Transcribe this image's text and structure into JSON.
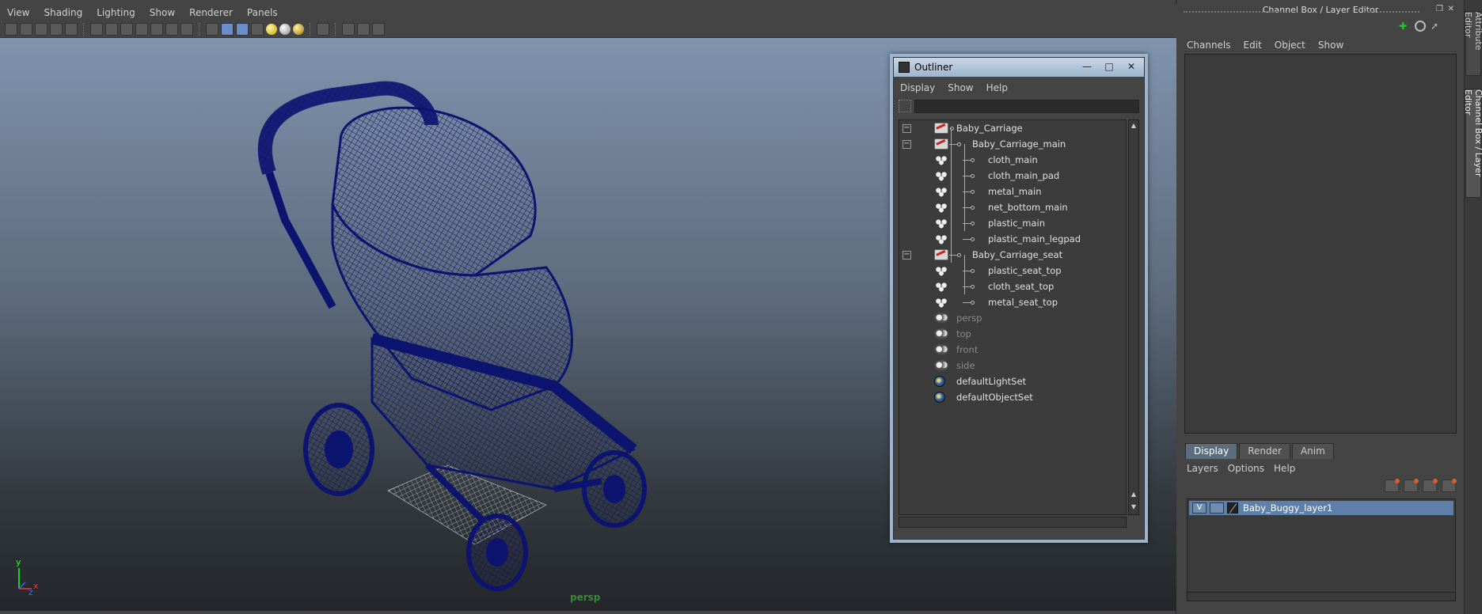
{
  "viewport": {
    "menu": [
      "View",
      "Shading",
      "Lighting",
      "Show",
      "Renderer",
      "Panels"
    ],
    "camera_label": "persp",
    "axis": {
      "y": "y",
      "x": "x",
      "z": "z"
    }
  },
  "outliner": {
    "title": "Outliner",
    "menu": [
      "Display",
      "Show",
      "Help"
    ],
    "filter_value": "",
    "nodes": [
      {
        "label": "Baby_Carriage",
        "type": "group",
        "depth": 0,
        "expanded": true,
        "dim": false
      },
      {
        "label": "Baby_Carriage_main",
        "type": "group",
        "depth": 1,
        "expanded": true,
        "dim": false
      },
      {
        "label": "cloth_main",
        "type": "mesh",
        "depth": 2,
        "dim": false
      },
      {
        "label": "cloth_main_pad",
        "type": "mesh",
        "depth": 2,
        "dim": false
      },
      {
        "label": "metal_main",
        "type": "mesh",
        "depth": 2,
        "dim": false
      },
      {
        "label": "net_bottom_main",
        "type": "mesh",
        "depth": 2,
        "dim": false
      },
      {
        "label": "plastic_main",
        "type": "mesh",
        "depth": 2,
        "dim": false
      },
      {
        "label": "plastic_main_legpad",
        "type": "mesh",
        "depth": 2,
        "dim": false
      },
      {
        "label": "Baby_Carriage_seat",
        "type": "group",
        "depth": 1,
        "expanded": true,
        "dim": false
      },
      {
        "label": "plastic_seat_top",
        "type": "mesh",
        "depth": 2,
        "dim": false
      },
      {
        "label": "cloth_seat_top",
        "type": "mesh",
        "depth": 2,
        "dim": false
      },
      {
        "label": "metal_seat_top",
        "type": "mesh",
        "depth": 2,
        "dim": false
      },
      {
        "label": "persp",
        "type": "camera",
        "depth": 0,
        "dim": true
      },
      {
        "label": "top",
        "type": "camera",
        "depth": 0,
        "dim": true
      },
      {
        "label": "front",
        "type": "camera",
        "depth": 0,
        "dim": true
      },
      {
        "label": "side",
        "type": "camera",
        "depth": 0,
        "dim": true
      },
      {
        "label": "defaultLightSet",
        "type": "set",
        "depth": 0,
        "dim": false
      },
      {
        "label": "defaultObjectSet",
        "type": "set",
        "depth": 0,
        "dim": false
      }
    ]
  },
  "channel_box": {
    "title": "Channel Box / Layer Editor",
    "menu": [
      "Channels",
      "Edit",
      "Object",
      "Show"
    ]
  },
  "layer_editor": {
    "tabs": [
      "Display",
      "Render",
      "Anim"
    ],
    "active_tab": "Display",
    "menu": [
      "Layers",
      "Options",
      "Help"
    ],
    "layers": [
      {
        "visible_flag": "V",
        "name": "Baby_Buggy_layer1"
      }
    ]
  },
  "side_tabs": [
    "Attribute Editor",
    "Channel Box / Layer Editor"
  ],
  "colors": {
    "wireframe": "#0c1470",
    "selection": "#5d7fa8",
    "camera_label": "#3a8a3a"
  }
}
